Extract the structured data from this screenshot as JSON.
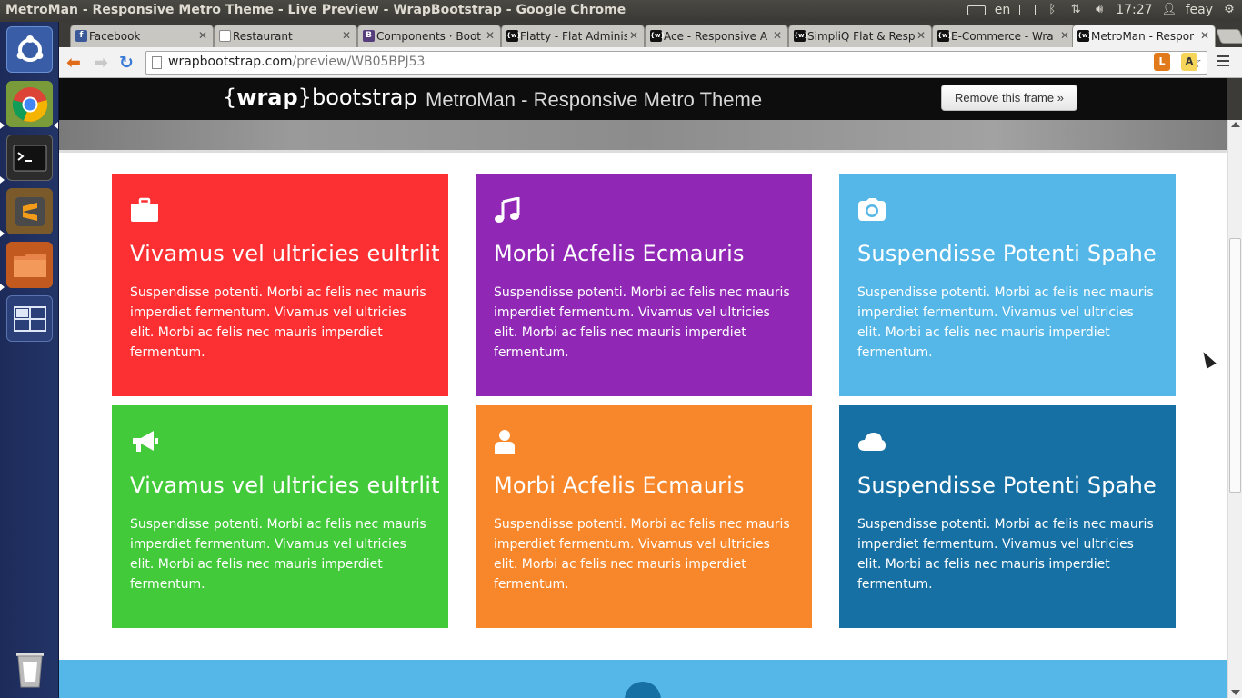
{
  "os": {
    "window_title": "MetroMan - Responsive Metro Theme - Live Preview - WrapBootstrap - Google Chrome",
    "keyboard_layout": "en",
    "clock": "17:27",
    "user": "feay"
  },
  "browser": {
    "tabs": [
      {
        "label": "Facebook",
        "favicon": "f",
        "favicon_color": "#3b5998"
      },
      {
        "label": "Restaurant",
        "favicon": "",
        "favicon_color": "#ffffff"
      },
      {
        "label": "Components · Boot",
        "favicon": "B",
        "favicon_color": "#563d7c"
      },
      {
        "label": "Flatty - Flat Adminis",
        "favicon": "{w}",
        "favicon_color": "#111111"
      },
      {
        "label": "Ace - Responsive A",
        "favicon": "{w}",
        "favicon_color": "#111111"
      },
      {
        "label": "SimpliQ Flat & Resp",
        "favicon": "{w}",
        "favicon_color": "#111111"
      },
      {
        "label": "E-Commerce - Wra",
        "favicon": "{w}",
        "favicon_color": "#111111"
      },
      {
        "label": "MetroMan - Respor",
        "favicon": "{w}",
        "favicon_color": "#111111",
        "active": true
      }
    ],
    "url_host": "wrapbootstrap.com",
    "url_path": "/preview/WB05BPJ53"
  },
  "frame": {
    "brand_open": "{",
    "brand_bold": "wrap",
    "brand_close": "}",
    "brand_rest": "bootstrap",
    "title": "MetroMan - Responsive Metro Theme",
    "remove_button": "Remove this frame »"
  },
  "tiles": [
    {
      "title": "Vivamus vel ultricies eultrlit",
      "text": "Suspendisse potenti. Morbi ac felis nec mauris imperdiet fermentum. Vivamus vel ultricies elit. Morbi ac felis nec mauris imperdiet fermentum.",
      "color": "#fc3032",
      "icon": "briefcase-icon"
    },
    {
      "title": "Morbi Acfelis Ecmauris",
      "text": "Suspendisse potenti. Morbi ac felis nec mauris imperdiet fermentum. Vivamus vel ultricies elit. Morbi ac felis nec mauris imperdiet fermentum.",
      "color": "#9028b5",
      "icon": "music-icon"
    },
    {
      "title": "Suspendisse Potenti Spahe",
      "text": "Suspendisse potenti. Morbi ac felis nec mauris imperdiet fermentum. Vivamus vel ultricies elit. Morbi ac felis nec mauris imperdiet fermentum.",
      "color": "#55b7e7",
      "icon": "camera-icon"
    },
    {
      "title": "Vivamus vel ultricies eultrlit",
      "text": "Suspendisse potenti. Morbi ac felis nec mauris imperdiet fermentum. Vivamus vel ultricies elit. Morbi ac felis nec mauris imperdiet fermentum.",
      "color": "#43ca3a",
      "icon": "bullhorn-icon"
    },
    {
      "title": "Morbi Acfelis Ecmauris",
      "text": "Suspendisse potenti. Morbi ac felis nec mauris imperdiet fermentum. Vivamus vel ultricies elit. Morbi ac felis nec mauris imperdiet fermentum.",
      "color": "#f8872b",
      "icon": "user-icon"
    },
    {
      "title": "Suspendisse Potenti Spahe",
      "text": "Suspendisse potenti. Morbi ac felis nec mauris imperdiet fermentum. Vivamus vel ultricies elit. Morbi ac felis nec mauris imperdiet fermentum.",
      "color": "#1670a4",
      "icon": "cloud-icon"
    }
  ],
  "launcher": [
    "dash-icon",
    "chrome-icon",
    "terminal-icon",
    "sublime-text-icon",
    "files-icon",
    "workspace-switcher-icon",
    "trash-icon"
  ]
}
